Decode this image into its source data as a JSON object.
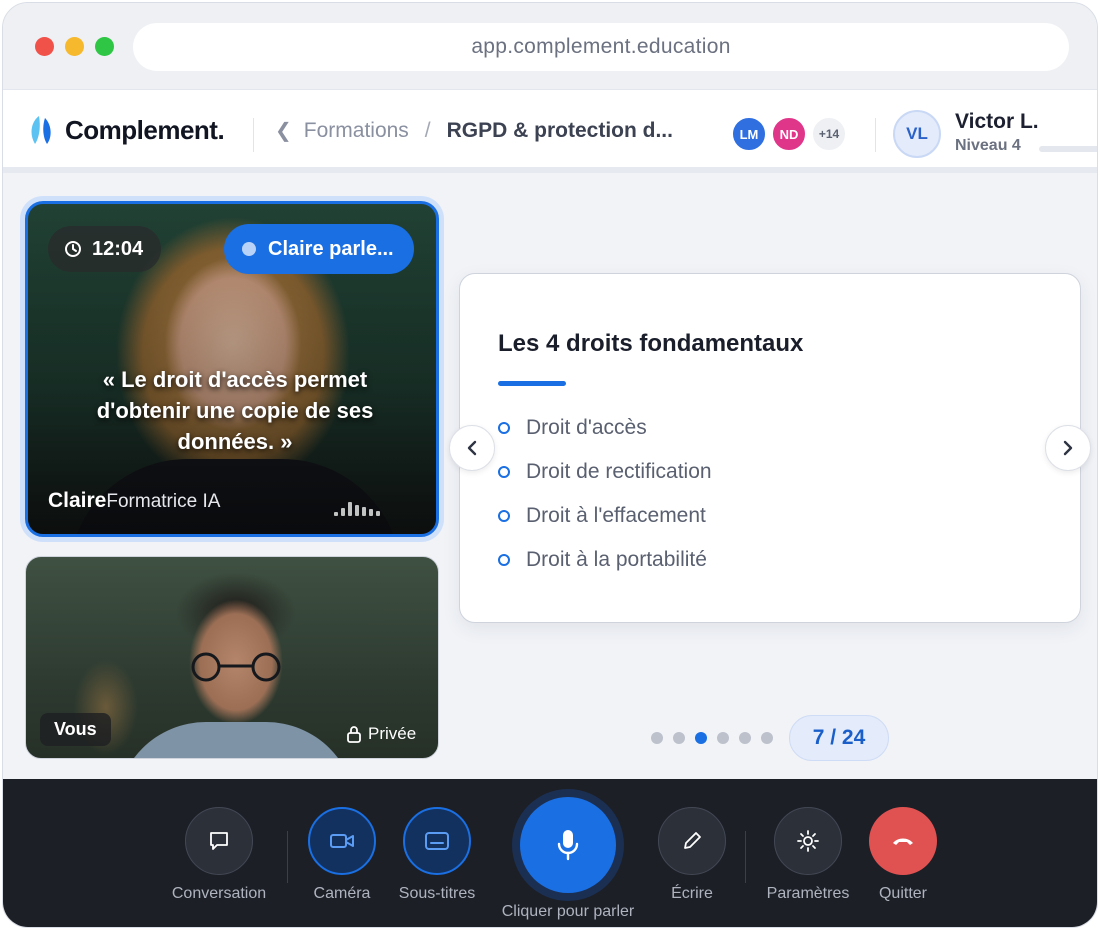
{
  "browser": {
    "url": "app.complement.education"
  },
  "header": {
    "logo_text": "Complement.",
    "breadcrumb": {
      "back_label": "Formations",
      "separator": "/",
      "current": "RGPD & protection d..."
    },
    "participants": [
      {
        "initials": "LM",
        "color": "#2f6fe0"
      },
      {
        "initials": "ND",
        "color": "#e0368a"
      }
    ],
    "participants_more": "+14",
    "user": {
      "initials": "VL",
      "name": "Victor L.",
      "level": "Niveau 4"
    }
  },
  "tutor": {
    "time": "12:04",
    "status": "Claire parle...",
    "caption": "« Le droit d'accès permet d'obtenir une copie de ses données. »",
    "name": "Claire",
    "role": "Formatrice IA"
  },
  "self_view": {
    "label": "Vous",
    "privacy": "Privée"
  },
  "slide": {
    "title": "Les 4 droits fondamentaux",
    "items": [
      "Droit d'accès",
      "Droit de rectification",
      "Droit à l'effacement",
      "Droit à la portabilité"
    ]
  },
  "pagination": {
    "current": 7,
    "total": 24,
    "label": "7 / 24",
    "dot_count": 6,
    "active_dot": 3
  },
  "controls": {
    "conversation": "Conversation",
    "camera": "Caméra",
    "subtitles": "Sous-titres",
    "talk": "Cliquer pour parler",
    "write": "Écrire",
    "settings": "Paramètres",
    "quit": "Quitter"
  },
  "colors": {
    "accent": "#1a6fe3",
    "danger": "#e05252",
    "control_bar": "#1c1f26"
  }
}
